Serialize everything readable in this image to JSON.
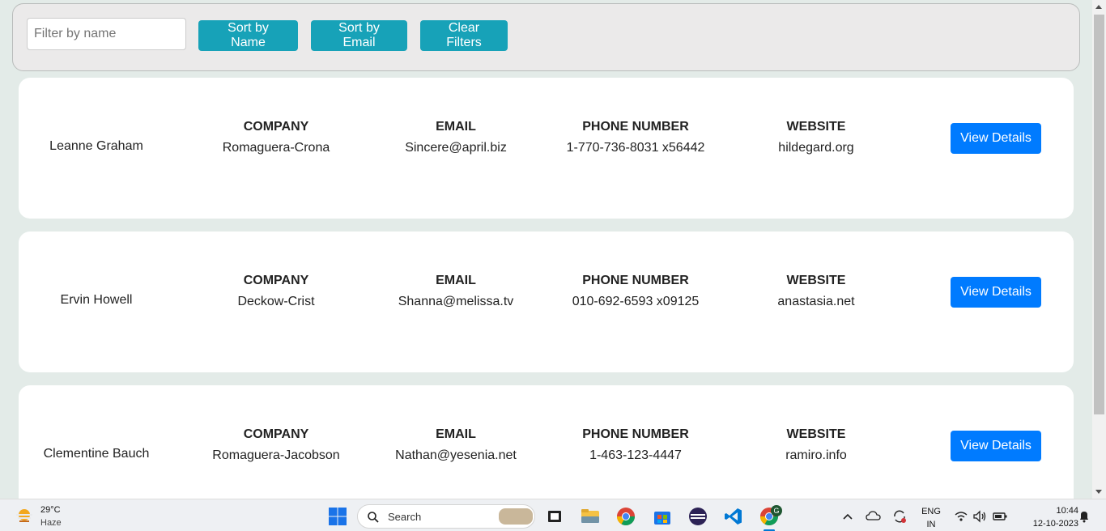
{
  "filters": {
    "name_placeholder": "Filter by name",
    "sort_name_label": "Sort by Name",
    "sort_email_label": "Sort by Email",
    "clear_label": "Clear Filters"
  },
  "column_labels": {
    "company": "COMPANY",
    "email": "EMAIL",
    "phone": "PHONE NUMBER",
    "website": "WEBSITE"
  },
  "view_details_label": "View Details",
  "users": [
    {
      "name": "Leanne Graham",
      "company": "Romaguera-Crona",
      "email": "Sincere@april.biz",
      "phone": "1-770-736-8031 x56442",
      "website": "hildegard.org"
    },
    {
      "name": "Ervin Howell",
      "company": "Deckow-Crist",
      "email": "Shanna@melissa.tv",
      "phone": "010-692-6593 x09125",
      "website": "anastasia.net"
    },
    {
      "name": "Clementine Bauch",
      "company": "Romaguera-Jacobson",
      "email": "Nathan@yesenia.net",
      "phone": "1-463-123-4447",
      "website": "ramiro.info"
    }
  ],
  "taskbar": {
    "weather_temp": "29°C",
    "weather_condition": "Haze",
    "search_label": "Search",
    "language": "ENG",
    "region": "IN",
    "time": "10:44",
    "date": "12-10-2023",
    "chrome_badge": "G"
  },
  "colors": {
    "teal_button": "#17a2b8",
    "primary_button": "#007bff",
    "page_background": "#e3ebe8"
  }
}
